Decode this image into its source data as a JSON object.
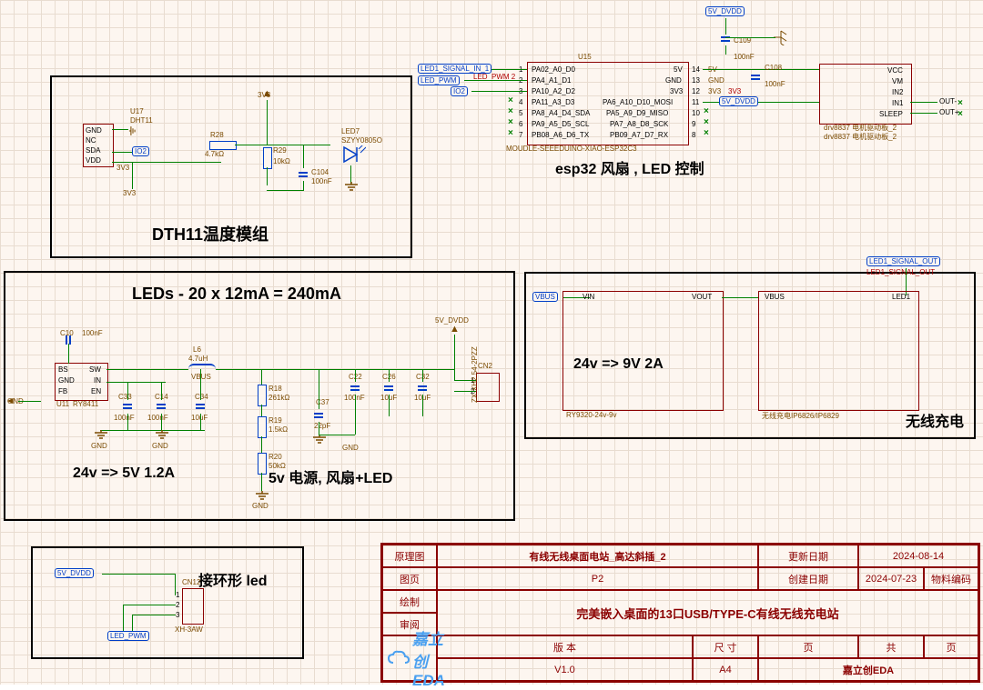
{
  "domain": "Diagram",
  "sections": {
    "dth11": {
      "title": "DTH11温度模组"
    },
    "leds": {
      "title": "LEDs - 20 x 12mA = 240mA",
      "sub1": "24v => 5V 1.2A",
      "sub2": "5v 电源, 风扇+LED"
    },
    "ring": {
      "title": "接环形 led"
    },
    "esp32": {
      "title": "esp32  风扇 , LED 控制"
    },
    "wireless": {
      "title": "无线充电",
      "sub": "24v => 9V 2A"
    }
  },
  "nets": {
    "v5_dvdd": "5V_DVDD",
    "v3v3": "3V3",
    "gnd": "GND",
    "vbus": "VBUS",
    "led_pwm": "LED_PWM",
    "io2": "IO2",
    "led1_sig_in": "LED1_SIGNAL_IN_1",
    "led1_sig_out": "LED1_SIGNAL_OUT",
    "out_plus": "OUT+",
    "out_minus": "OUT-",
    "led_pwm_2": "LED_PWM 2",
    "vin": "VIN",
    "vout": "VOUT",
    "led1": "LED1"
  },
  "parts": {
    "u17": {
      "ref": "U17",
      "value": "DHT11",
      "pins": [
        "GND",
        "NC",
        "SDA",
        "VDD"
      ]
    },
    "r28": {
      "ref": "R28",
      "value": "4.7kΩ"
    },
    "r29": {
      "ref": "R29",
      "value": "10kΩ"
    },
    "c104": {
      "ref": "C104",
      "value": "100nF"
    },
    "led7": {
      "ref": "LED7",
      "value": "SZYY0805O"
    },
    "u15": {
      "ref": "U15",
      "value": "MOUDLE-SEEEDUINO-XIAO-ESP32C3",
      "left": [
        "PA02_A0_D0",
        "PA4_A1_D1",
        "PA10_A2_D2",
        "PA11_A3_D3",
        "PA8_A4_D4_SDA",
        "PA9_A5_D5_SCL",
        "PB08_A6_D6_TX"
      ],
      "right": [
        "5V",
        "GND",
        "3V3",
        "PA6_A10_D10_MOSI",
        "PA5_A9_D9_MISO",
        "PA7_A8_D8_SCK",
        "PB09_A7_D7_RX"
      ],
      "right_nums": [
        "14",
        "13",
        "12",
        "11",
        "10",
        "9",
        "8"
      ]
    },
    "c108": {
      "ref": "C108",
      "value": "100nF"
    },
    "c109": {
      "ref": "C109",
      "value": "100nF"
    },
    "drv": {
      "ref": "drv8837 电机驱动板_2",
      "value": "drv8837 电机驱动板_2",
      "pins": [
        "VCC",
        "VM",
        "IN2",
        "IN1",
        "SLEEP"
      ]
    },
    "u11": {
      "ref": "U11",
      "value": "RY8411",
      "pins": [
        "BS",
        "GND",
        "FB",
        "SW",
        "IN",
        "EN"
      ]
    },
    "c10": {
      "ref": "C10",
      "value": "100nF"
    },
    "l6": {
      "ref": "L6",
      "value": "4.7uH"
    },
    "c33": {
      "ref": "C33",
      "value": "100nF"
    },
    "c14": {
      "ref": "C14",
      "value": "100nF"
    },
    "c34": {
      "ref": "C34",
      "value": "10uF"
    },
    "c37": {
      "ref": "C37",
      "value": "22pF"
    },
    "c22": {
      "ref": "C22",
      "value": "100nF"
    },
    "c26": {
      "ref": "C26",
      "value": "10uF"
    },
    "c32": {
      "ref": "C32",
      "value": "10uF"
    },
    "r18": {
      "ref": "R18",
      "value": "261kΩ"
    },
    "r19": {
      "ref": "R19",
      "value": "1.5kΩ"
    },
    "r20": {
      "ref": "R20",
      "value": "50kΩ"
    },
    "cn2": {
      "ref": "CN2",
      "value": "ZX-XH2.54-2PZZ",
      "pins": [
        "1",
        "2"
      ]
    },
    "cn12": {
      "ref": "CN12",
      "value": "XH-3AW",
      "pins": [
        "1",
        "2",
        "3"
      ]
    },
    "ry9320": {
      "ref": "RY9320-24v-9v"
    },
    "wc_chip": {
      "ref": "无线充电IP6826/IP6829"
    }
  },
  "title_block": {
    "r1c1": "原理图",
    "r1c2": "有线无线桌面电站_高达斜插_2",
    "r1c3": "更新日期",
    "r1c4": "2024-08-14",
    "r2c1": "图页",
    "r2c2": "P2",
    "r2c3": "创建日期",
    "r2c4": "2024-07-23",
    "r2c5": "物料编码",
    "r3c1": "绘制",
    "r3c2": "完美嵌入桌面的13口USB/TYPE-C有线无线充电站",
    "r4c1": "审阅",
    "r5c1": "版     本",
    "r5c2": "尺     寸",
    "r5c3": "页",
    "r5c4": "共",
    "r5c5": "页",
    "r6c1": "V1.0",
    "r6c2": "A4",
    "r6c3": "嘉立创EDA"
  },
  "brand": "嘉立创EDA"
}
